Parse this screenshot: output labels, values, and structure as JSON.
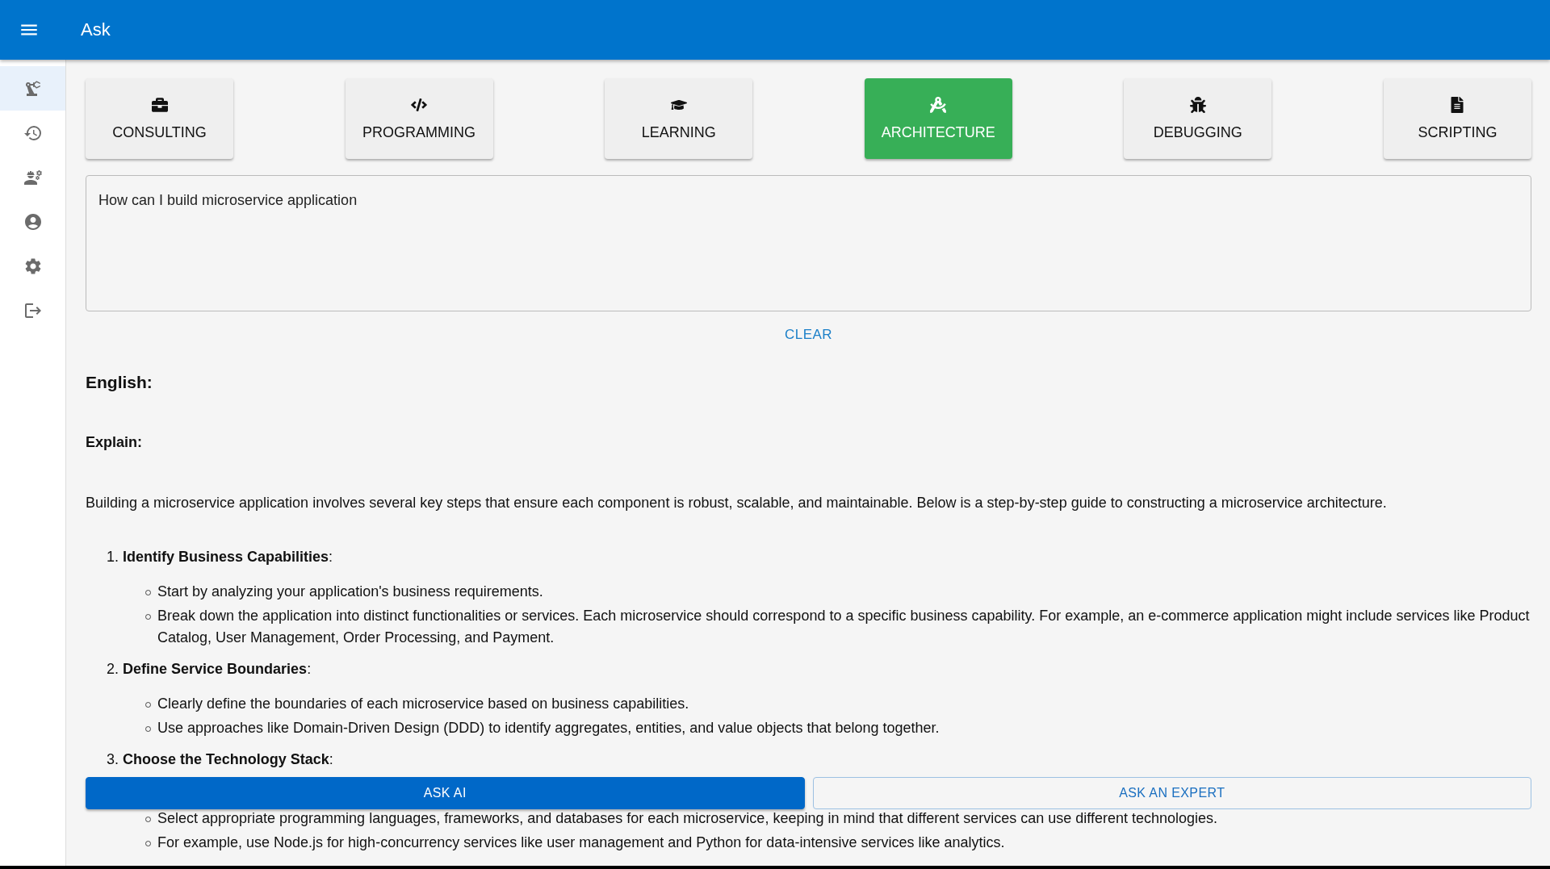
{
  "app_bar": {
    "title": "Ask"
  },
  "sidebar": {
    "items": [
      {
        "selected": true
      },
      {
        "selected": false
      },
      {
        "selected": false
      },
      {
        "selected": false
      },
      {
        "selected": false
      },
      {
        "selected": false
      }
    ]
  },
  "categories": [
    {
      "label": "CONSULTING",
      "selected": false
    },
    {
      "label": "PROGRAMMING",
      "selected": false
    },
    {
      "label": "LEARNING",
      "selected": false
    },
    {
      "label": "ARCHITECTURE",
      "selected": true
    },
    {
      "label": "DEBUGGING",
      "selected": false
    },
    {
      "label": "SCRIPTING",
      "selected": false
    }
  ],
  "question": {
    "value": "How can I build microservice application"
  },
  "clear_button": "CLEAR",
  "answer": {
    "heading": "English:",
    "subheading": "Explain:",
    "intro": "Building a microservice application involves several key steps that ensure each component is robust, scalable, and maintainable. Below is a step-by-step guide to constructing a microservice architecture.",
    "steps": [
      {
        "number": "1.",
        "title": "**Identify Business Capabilities**:",
        "bullets": [
          "Start by analyzing your application's business requirements.",
          "Break down the application into distinct functionalities or services. Each microservice should correspond to a specific business capability. For example, an e-commerce application might include services like Product Catalog, User Management, Order Processing, and Payment."
        ]
      },
      {
        "number": "2.",
        "title": "**Define Service Boundaries**:",
        "bullets": [
          "Clearly define the boundaries of each microservice based on business capabilities.",
          "Use approaches like Domain-Driven Design (DDD) to identify aggregates, entities, and value objects that belong together."
        ]
      },
      {
        "number": "3.",
        "title": "**Choose the Technology Stack**:",
        "bullets": [
          "Select appropriate programming languages, frameworks, and databases for each microservice, keeping in mind that different services can use different technologies.",
          "For example, use Node.js for high-concurrency services like user management and Python for data-intensive services like analytics."
        ]
      }
    ]
  },
  "actions": [
    {
      "label": "ASK AI",
      "kind": "contained"
    },
    {
      "label": "ASK AN EXPERT",
      "kind": "outlined"
    }
  ]
}
